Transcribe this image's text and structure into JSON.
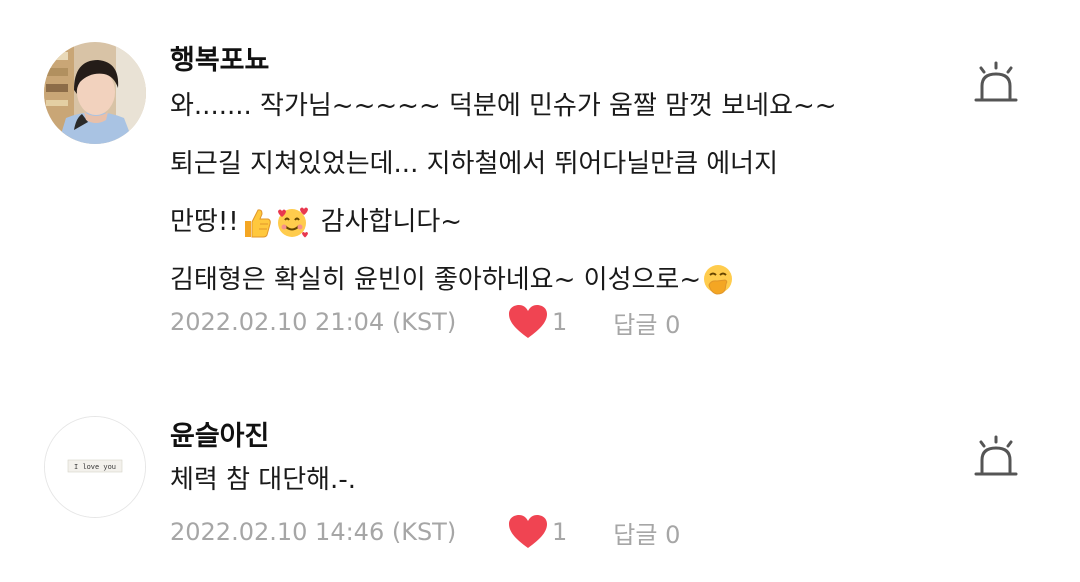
{
  "comments": [
    {
      "username": "행복포뇨",
      "avatar_icon": "profile-photo-man",
      "lines": [
        "와....... 작가님~~~~~ 덕분에 민슈가 움짤 맘껏 보네요~~",
        "퇴근길 지쳐있었는데... 지하철에서 뛰어다닐만큼 에너지",
        "만땅!!",
        "감사합니다~",
        "김태형은 확실히 윤빈이 좋아하네요~ 이성으로~"
      ],
      "emojis": [
        "thumbs-up-icon",
        "smiling-face-with-hearts-icon",
        "face-with-hand-over-mouth-icon"
      ],
      "timestamp": "2022.02.10 21:04 (KST)",
      "likes": "1",
      "reply_label": "답글 0",
      "report_icon": "siren-icon"
    },
    {
      "username": "윤슬아진",
      "avatar_icon": "profile-image-i-love-you",
      "avatar_text": "I love you",
      "lines": [
        "체력 참 대단해.-."
      ],
      "timestamp": "2022.02.10 14:46 (KST)",
      "likes": "1",
      "reply_label": "답글 0",
      "report_icon": "siren-icon"
    }
  ],
  "colors": {
    "heart": "#f04452",
    "meta_text": "#a6a6a6",
    "report_icon": "#555555"
  }
}
